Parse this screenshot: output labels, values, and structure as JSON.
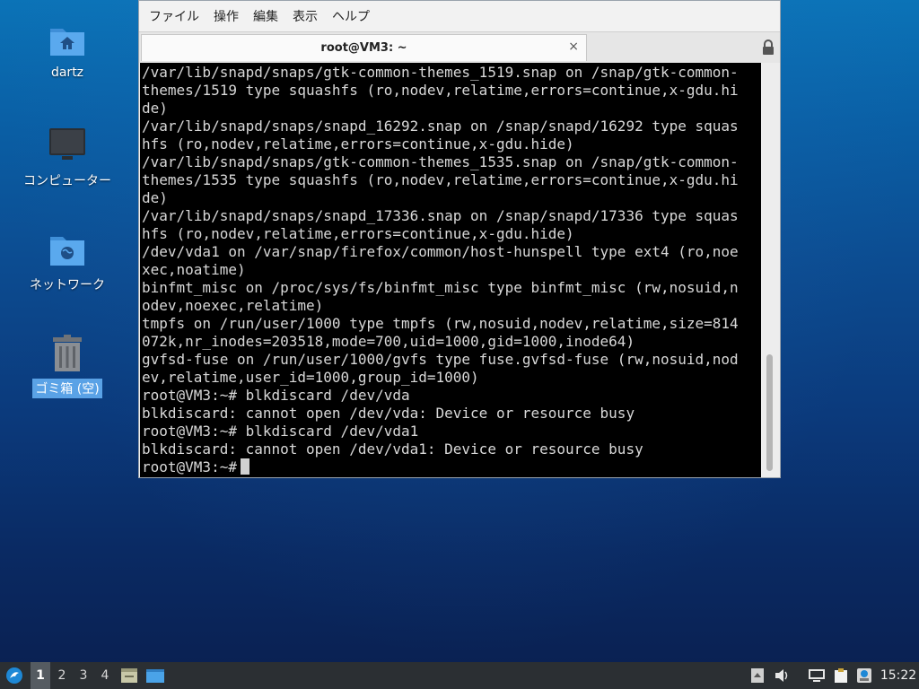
{
  "desktop": {
    "icons": [
      {
        "label": "dartz",
        "icon": "home-folder-icon"
      },
      {
        "label": "コンピューター",
        "icon": "computer-monitor-icon"
      },
      {
        "label": "ネットワーク",
        "icon": "network-folder-icon"
      },
      {
        "label": "ゴミ箱 (空)",
        "icon": "trash-icon",
        "selected": true
      }
    ]
  },
  "window": {
    "menu": [
      "ファイル",
      "操作",
      "編集",
      "表示",
      "ヘルプ"
    ],
    "tab_title": "root@VM3: ~",
    "tab_close": "×",
    "terminal_lines": [
      "/var/lib/snapd/snaps/gtk-common-themes_1519.snap on /snap/gtk-common-",
      "themes/1519 type squashfs (ro,nodev,relatime,errors=continue,x-gdu.hi",
      "de)",
      "/var/lib/snapd/snaps/snapd_16292.snap on /snap/snapd/16292 type squas",
      "hfs (ro,nodev,relatime,errors=continue,x-gdu.hide)",
      "/var/lib/snapd/snaps/gtk-common-themes_1535.snap on /snap/gtk-common-",
      "themes/1535 type squashfs (ro,nodev,relatime,errors=continue,x-gdu.hi",
      "de)",
      "/var/lib/snapd/snaps/snapd_17336.snap on /snap/snapd/17336 type squas",
      "hfs (ro,nodev,relatime,errors=continue,x-gdu.hide)",
      "/dev/vda1 on /var/snap/firefox/common/host-hunspell type ext4 (ro,noe",
      "xec,noatime)",
      "binfmt_misc on /proc/sys/fs/binfmt_misc type binfmt_misc (rw,nosuid,n",
      "odev,noexec,relatime)",
      "tmpfs on /run/user/1000 type tmpfs (rw,nosuid,nodev,relatime,size=814",
      "072k,nr_inodes=203518,mode=700,uid=1000,gid=1000,inode64)",
      "gvfsd-fuse on /run/user/1000/gvfs type fuse.gvfsd-fuse (rw,nosuid,nod",
      "ev,relatime,user_id=1000,group_id=1000)",
      "root@VM3:~# blkdiscard /dev/vda",
      "blkdiscard: cannot open /dev/vda: Device or resource busy",
      "root@VM3:~# blkdiscard /dev/vda1",
      "blkdiscard: cannot open /dev/vda1: Device or resource busy"
    ],
    "prompt": "root@VM3:~#"
  },
  "taskbar": {
    "workspaces": [
      "1",
      "2",
      "3",
      "4"
    ],
    "active_workspace": "1",
    "clock": "15:22"
  },
  "colors": {
    "terminal_bg": "#000000",
    "terminal_fg": "#d8d8d8",
    "taskbar_bg": "#2b2f33",
    "selection": "#5aa2e6"
  }
}
